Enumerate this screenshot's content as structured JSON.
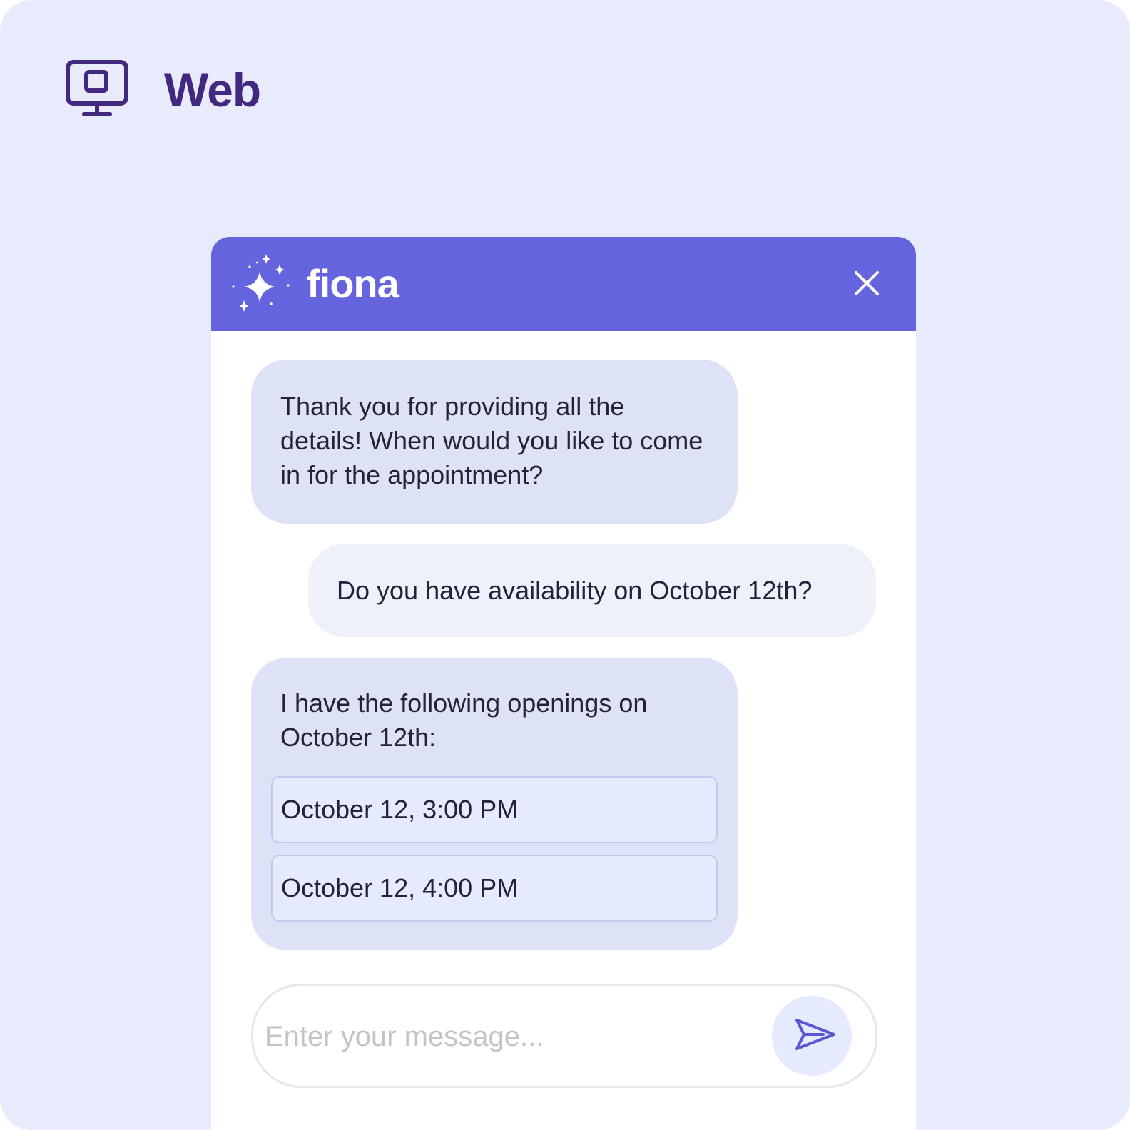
{
  "platform": {
    "label": "Web",
    "icon": "monitor-icon"
  },
  "chat": {
    "title": "fiona",
    "logo_icon": "sparkle-icon",
    "close_icon": "close-icon",
    "messages": [
      {
        "sender": "bot",
        "text": "Thank you for providing all the details! When would you like to come in for the appointment?"
      },
      {
        "sender": "user",
        "text": "Do you have availability on October 12th?"
      },
      {
        "sender": "bot",
        "text": "I have the following openings on October 12th:",
        "options": [
          "October 12, 3:00 PM",
          "October 12, 4:00 PM"
        ]
      }
    ],
    "input": {
      "placeholder": "Enter your message...",
      "value": ""
    },
    "send_icon": "send-icon"
  },
  "colors": {
    "background": "#e8ebfc",
    "header": "#6663df",
    "brand_text": "#42297f",
    "bot_bubble": "#dee2f7",
    "user_bubble": "#eef1fa",
    "send_icon": "#5a58d6"
  }
}
